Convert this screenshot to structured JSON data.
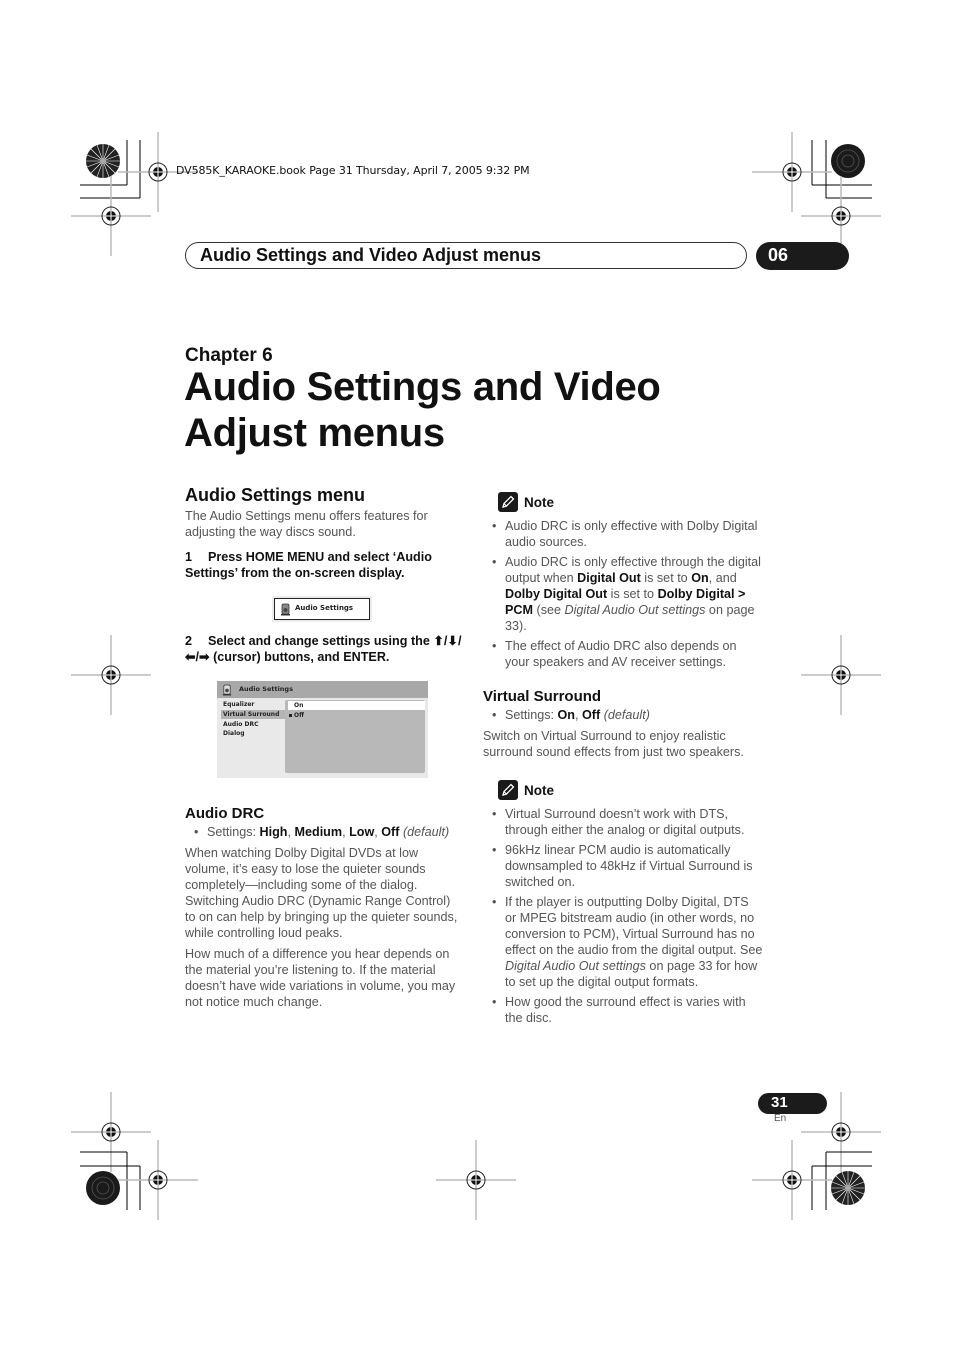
{
  "print_info": "DV585K_KARAOKE.book  Page 31  Thursday, April 7, 2005  9:32 PM",
  "header": {
    "section_title": "Audio Settings and Video Adjust menus",
    "chapter_number": "06"
  },
  "chapter": {
    "label": "Chapter 6",
    "title_line1": "Audio Settings and Video",
    "title_line2": "Adjust menus"
  },
  "left_column": {
    "heading": "Audio Settings menu",
    "intro": "The Audio Settings menu offers features for adjusting the way discs sound.",
    "step1": {
      "number": "1",
      "text": "Press HOME MENU and select ‘Audio Settings’ from the on-screen display."
    },
    "osd_small": {
      "label": "Audio Settings",
      "icon": "speaker-icon"
    },
    "step2": {
      "number": "2",
      "text": "Select and change settings using the ⬆/⬇/⬅/➡ (cursor) buttons, and ENTER."
    },
    "osd": {
      "title": "Audio Settings",
      "icon": "speaker-icon",
      "menu_items": [
        "Equalizer",
        "Virtual Surround",
        "Audio DRC",
        "Dialog"
      ],
      "selected_item": "Virtual Surround",
      "options": [
        "On",
        "Off"
      ],
      "highlighted_option": "On",
      "current_option": "Off"
    },
    "audio_drc": {
      "heading": "Audio DRC",
      "settings_prefix": "Settings: ",
      "settings": [
        "High",
        "Medium",
        "Low",
        "Off"
      ],
      "default_note": "(default)",
      "para1": "When watching Dolby Digital DVDs at low volume, it’s easy to lose the quieter sounds completely—including some of the dialog. Switching Audio DRC (Dynamic Range Control) to on can help by bringing up the quieter sounds, while controlling loud peaks.",
      "para2": "How much of a difference you hear depends on the material you’re listening to. If the material doesn’t have wide variations in volume, you may not notice much change."
    }
  },
  "right_column": {
    "note1": {
      "label": "Note",
      "items": [
        {
          "text": "Audio DRC is only effective with Dolby Digital audio sources."
        },
        {
          "parts": [
            {
              "t": "Audio DRC is only effective through the digital output when ",
              "s": "n"
            },
            {
              "t": "Digital Out",
              "s": "b"
            },
            {
              "t": " is set to ",
              "s": "n"
            },
            {
              "t": "On",
              "s": "b"
            },
            {
              "t": ", and ",
              "s": "n"
            },
            {
              "t": "Dolby Digital Out",
              "s": "b"
            },
            {
              "t": " is set to ",
              "s": "n"
            },
            {
              "t": "Dolby Digital > PCM",
              "s": "b"
            },
            {
              "t": " (see ",
              "s": "n"
            },
            {
              "t": "Digital Audio Out settings",
              "s": "i"
            },
            {
              "t": " on page 33).",
              "s": "n"
            }
          ]
        },
        {
          "text": "The effect of Audio DRC also depends on your speakers and AV receiver settings."
        }
      ]
    },
    "virtual_surround": {
      "heading": "Virtual Surround",
      "settings_prefix": "Settings: ",
      "settings": [
        "On",
        "Off"
      ],
      "default_note": "(default)",
      "para": "Switch on Virtual Surround to enjoy realistic surround sound effects from just two speakers."
    },
    "note2": {
      "label": "Note",
      "items": [
        {
          "text": "Virtual Surround doesn’t work with DTS, through either the analog or digital outputs."
        },
        {
          "text": "96kHz linear PCM audio is automatically downsampled to 48kHz if Virtual Surround is switched on."
        },
        {
          "parts": [
            {
              "t": "If the player is outputting Dolby Digital, DTS or MPEG bitstream audio (in other words, no conversion to PCM), Virtual Surround has no effect on the audio from the digital output. See ",
              "s": "n"
            },
            {
              "t": "Digital Audio Out settings",
              "s": "i"
            },
            {
              "t": " on page 33 for how to set up the digital output formats.",
              "s": "n"
            }
          ]
        },
        {
          "text": "How good the surround effect is varies with the disc."
        }
      ]
    }
  },
  "footer": {
    "page_number": "31",
    "language": "En"
  }
}
